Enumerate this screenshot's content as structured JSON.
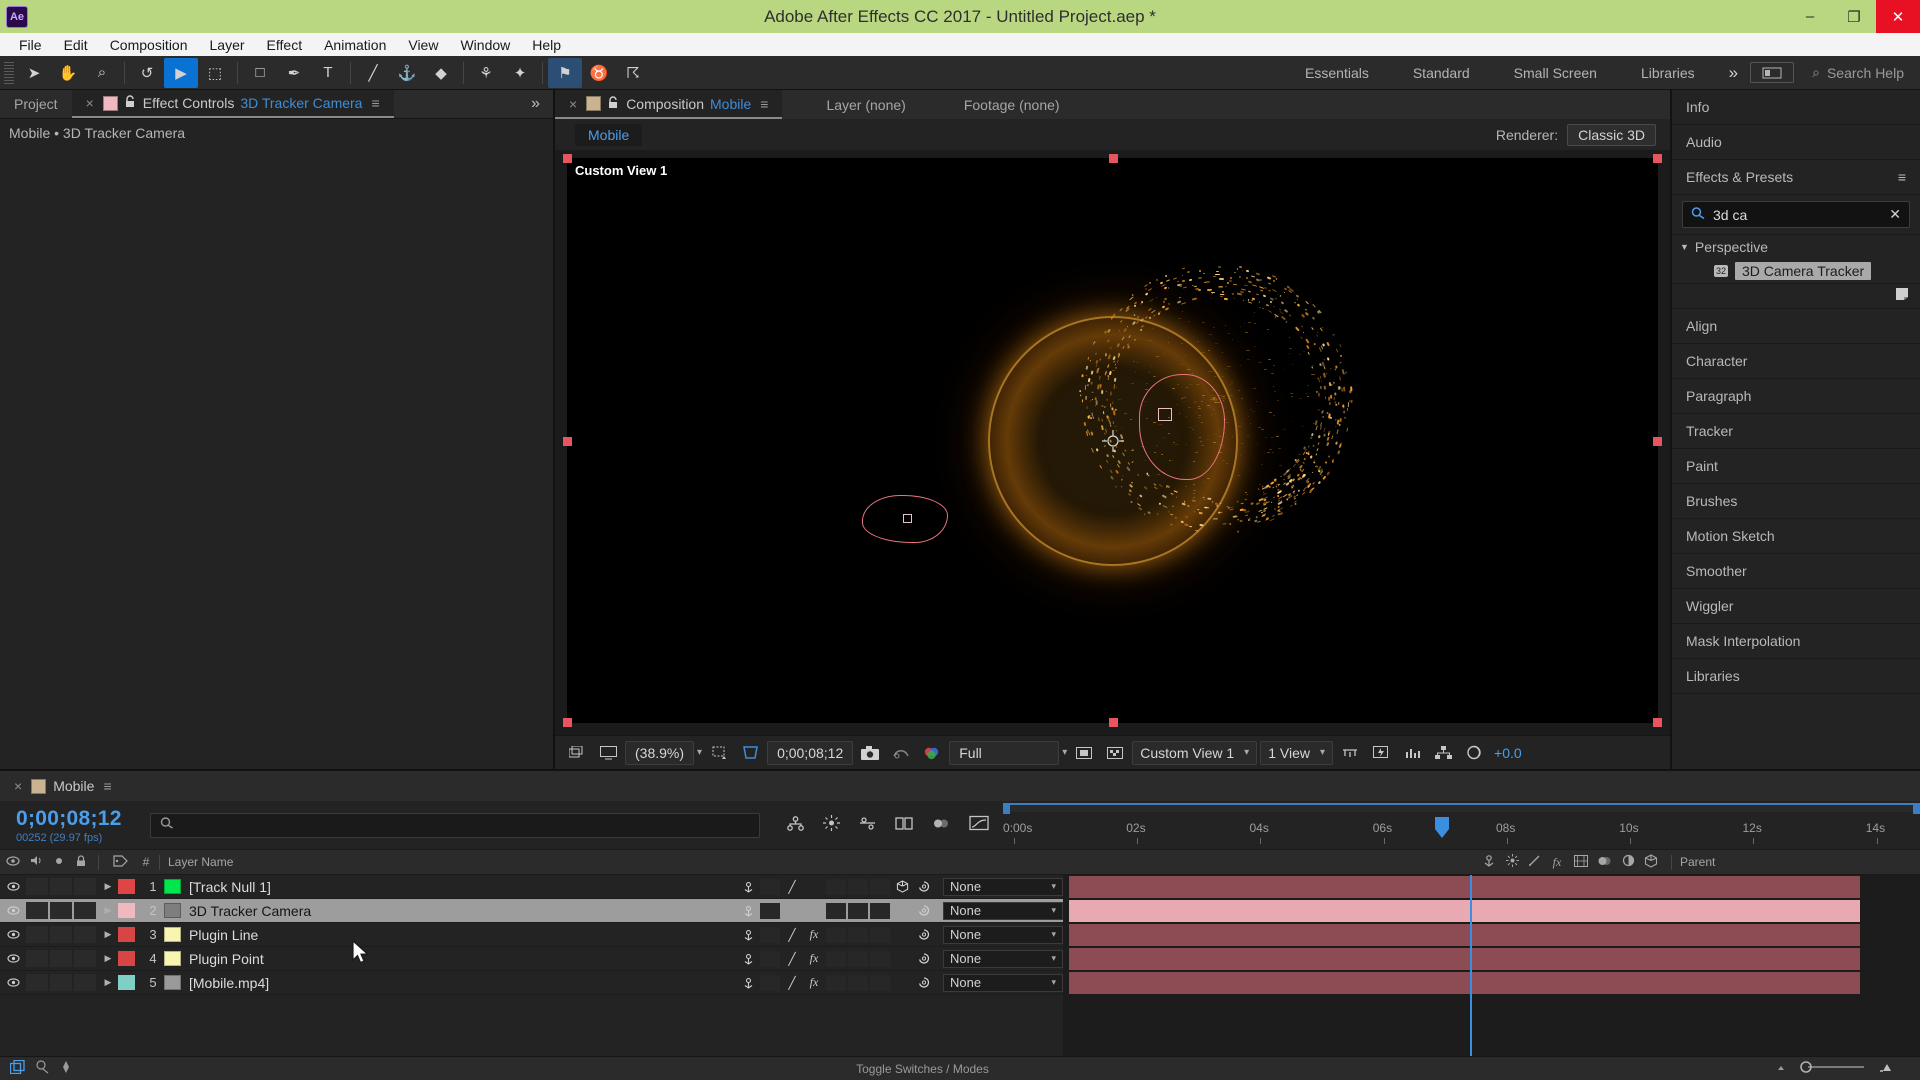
{
  "window": {
    "title": "Adobe After Effects CC 2017 - Untitled Project.aep *",
    "logo": "Ae",
    "minimize": "–",
    "maximize": "❐",
    "close": "✕",
    "titlebar_color": "#b9d780"
  },
  "menu": [
    "File",
    "Edit",
    "Composition",
    "Layer",
    "Effect",
    "Animation",
    "View",
    "Window",
    "Help"
  ],
  "toolbar": {
    "tools": [
      {
        "name": "selection-tool",
        "glyph": "➤",
        "selected": false
      },
      {
        "name": "hand-tool",
        "glyph": "✋",
        "selected": false
      },
      {
        "name": "zoom-tool",
        "glyph": "⌕",
        "selected": false
      },
      {
        "name": "rotation-tool",
        "glyph": "↺",
        "selected": false
      },
      {
        "name": "camera-tool",
        "glyph": "▶",
        "selected": true
      },
      {
        "name": "pan-behind-tool",
        "glyph": "⬚",
        "selected": false
      },
      {
        "name": "shape-tool",
        "glyph": "□",
        "selected": false
      },
      {
        "name": "pen-tool",
        "glyph": "✒",
        "selected": false
      },
      {
        "name": "type-tool",
        "glyph": "T",
        "selected": false
      },
      {
        "name": "brush-tool",
        "glyph": "╱",
        "selected": false
      },
      {
        "name": "clone-stamp-tool",
        "glyph": "⚓",
        "selected": false
      },
      {
        "name": "eraser-tool",
        "glyph": "◆",
        "selected": false
      },
      {
        "name": "roto-brush-tool",
        "glyph": "⚘",
        "selected": false
      },
      {
        "name": "puppet-tool",
        "glyph": "✦",
        "selected": false
      },
      {
        "name": "puppet-pin-tool",
        "glyph": "⚑",
        "selected": true
      },
      {
        "name": "puppet-starch-tool",
        "glyph": "♉",
        "selected": false
      },
      {
        "name": "puppet-overlap-tool",
        "glyph": "☈",
        "selected": false
      }
    ],
    "workspaces": [
      {
        "label": "Essentials",
        "active": false
      },
      {
        "label": "Standard",
        "active": false
      },
      {
        "label": "Small Screen",
        "active": false
      },
      {
        "label": "Libraries",
        "active": false
      }
    ],
    "workspace_more": "»",
    "search_help_placeholder": "Search Help",
    "search_icon": "⌕"
  },
  "left_panel": {
    "tabs": [
      {
        "label": "Project",
        "active": false
      },
      {
        "label": "Effect Controls",
        "active": true,
        "highlight": "3D Tracker Camera"
      }
    ],
    "close_icon": "×",
    "lock_icon": "🔓",
    "menu_icon": "≡",
    "more_icon": "»",
    "subtitle": "Mobile • 3D Tracker Camera"
  },
  "composition": {
    "tabs": [
      {
        "label": "Composition",
        "value": "Mobile",
        "active": true
      },
      {
        "label": "Layer (none)",
        "value": "",
        "active": false
      },
      {
        "label": "Footage (none)",
        "value": "",
        "active": false
      }
    ],
    "close_icon": "×",
    "lock_icon": "🔓",
    "menu_icon": "≡",
    "comp_name": "Mobile",
    "renderer_label": "Renderer:",
    "renderer_value": "Classic 3D",
    "view_label": "Custom View 1",
    "viewer_bar": {
      "zoom": "(38.9%)",
      "timecode": "0;00;08;12",
      "resolution": "Full",
      "view_layout": "Custom View 1",
      "view_count": "1 View",
      "exposure": "+0.0",
      "icons": [
        "always-preview-icon",
        "monitor-icon",
        "region-of-interest-icon",
        "transparency-grid-icon",
        "snapshot-icon",
        "show-snapshot-icon",
        "channel-icon",
        "mask-guide-icon",
        "checkerboard-icon",
        "3d-ref-axes-icon",
        "fast-preview-icon",
        "timeline-graph-icon",
        "comp-flowchart-icon",
        "exposure-icon"
      ]
    }
  },
  "right_panel": {
    "rows": [
      "Info",
      "Audio"
    ],
    "effects_header": "Effects & Presets",
    "effects_menu_icon": "≡",
    "search_value": "3d ca",
    "search_icon": "⌕",
    "clear_icon": "✕",
    "category": "Perspective",
    "category_arrow": "▼",
    "effect_item": "3D Camera Tracker",
    "effect_icon": "32",
    "panels": [
      "Align",
      "Character",
      "Paragraph",
      "Tracker",
      "Paint",
      "Brushes",
      "Motion Sketch",
      "Smoother",
      "Wiggler",
      "Mask Interpolation",
      "Libraries"
    ]
  },
  "timeline": {
    "tab_label": "Mobile",
    "close_icon": "×",
    "menu_icon": "≡",
    "timecode": "0;00;08;12",
    "frame_info": "00252 (29.97 fps)",
    "search_icon": "⌕",
    "toolbar_icons": [
      "composition-mini-flowchart-icon",
      "draft-3d-icon",
      "hide-shy-layers-icon",
      "frame-blending-icon",
      "motion-blur-icon",
      "graph-editor-icon"
    ],
    "columns": {
      "eye": "◉",
      "audio": "◈",
      "solo": "●",
      "lock": "🔒",
      "label": "🏷",
      "number": "#",
      "layer_name": "Layer Name",
      "parent": "Parent",
      "switches": [
        "⚓",
        "☀",
        "╱",
        "fx",
        "▤",
        "◉",
        "◐",
        "⬡"
      ]
    },
    "layers": [
      {
        "num": "1",
        "name": "[Track Null 1]",
        "color": "#e04545",
        "swatch": "#00e64c",
        "selected": false,
        "switches": [
          "⚓",
          "",
          "╱",
          "",
          "",
          "",
          "",
          "⬡"
        ],
        "parent": "None",
        "bar_color": "#8d4b53"
      },
      {
        "num": "2",
        "name": "3D Tracker Camera",
        "color": "#f0b8bf",
        "swatch": "#7e7e7e",
        "selected": true,
        "switches": [
          "⚓",
          "",
          "",
          "",
          "",
          "",
          "",
          ""
        ],
        "parent": "None",
        "bar_color": "#e8a9b2"
      },
      {
        "num": "3",
        "name": "Plugin Line",
        "color": "#d84545",
        "swatch": "#f7f5b0",
        "selected": false,
        "switches": [
          "⚓",
          "",
          "╱",
          "fx",
          "",
          "",
          "",
          ""
        ],
        "parent": "None",
        "bar_color": "#8d4b53"
      },
      {
        "num": "4",
        "name": "Plugin Point",
        "color": "#d84545",
        "swatch": "#f7f5b0",
        "selected": false,
        "switches": [
          "⚓",
          "",
          "╱",
          "fx",
          "",
          "",
          "",
          ""
        ],
        "parent": "None",
        "bar_color": "#8d4b53"
      },
      {
        "num": "5",
        "name": "[Mobile.mp4]",
        "color": "#7fcfc4",
        "swatch": "#9a9a9a",
        "selected": false,
        "switches": [
          "⚓",
          "",
          "╱",
          "fx",
          "",
          "",
          "",
          ""
        ],
        "parent": "None",
        "bar_color": "#8d4b53"
      }
    ],
    "ruler_ticks": [
      "0:00s",
      "02s",
      "04s",
      "06s",
      "08s",
      "10s",
      "12s",
      "14s"
    ],
    "playhead_label": "08s",
    "status_text": "Toggle Switches / Modes",
    "status_icons": [
      "toggle-switches-icon",
      "transfer-controls-icon",
      "keyframe-nav-icon"
    ]
  },
  "colors": {
    "accent_blue": "#4a9eea",
    "title_green": "#b9d780",
    "close_red": "#e81123",
    "panel_bg": "#232323",
    "mask_pink": "#e8747e"
  }
}
